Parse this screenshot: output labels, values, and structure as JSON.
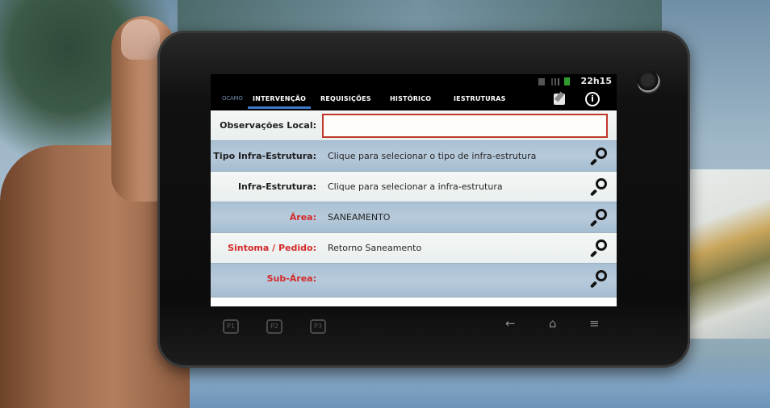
{
  "status_bar": {
    "time": "22h15"
  },
  "tab_bar": {
    "logo_text": "OCAMO",
    "tabs": [
      {
        "label": "INTERVENÇÃO",
        "active": true
      },
      {
        "label": "REQUISIÇÕES",
        "active": false
      },
      {
        "label": "HISTÓRICO",
        "active": false
      },
      {
        "label": "IESTRUTURAS",
        "active": false
      }
    ],
    "info_glyph": "i"
  },
  "form": {
    "observacoes": {
      "label": "Observações Local:",
      "value": ""
    },
    "rows": [
      {
        "label": "Tipo Infra-Estrutura:",
        "value": "Clique para selecionar o tipo de infra-estrutura",
        "required": false
      },
      {
        "label": "Infra-Estrutura:",
        "value": "Clique para selecionar a infra-estrutura",
        "required": false
      },
      {
        "label": "Área:",
        "value": "SANEAMENTO",
        "required": true
      },
      {
        "label": "Sintoma / Pedido:",
        "value": "Retorno Saneamento",
        "required": true
      },
      {
        "label": "Sub-Área:",
        "value": "",
        "required": true
      }
    ]
  },
  "softkeys": [
    "P1",
    "P2",
    "P3"
  ],
  "icons": {
    "status": [
      "sd-card-icon",
      "signal-icon",
      "battery-icon"
    ],
    "toolbar": [
      "edit-note-icon",
      "info-icon"
    ],
    "nav": [
      "back-icon",
      "home-icon",
      "menu-icon"
    ]
  },
  "colors": {
    "active_tab_underline": "#3e78c8",
    "required_label": "#d42a2a",
    "input_border": "#c0392b"
  }
}
